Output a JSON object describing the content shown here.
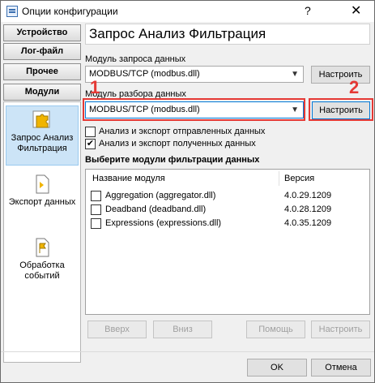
{
  "window": {
    "title": "Опции конфигурации",
    "help_glyph": "?",
    "close_glyph": "✕"
  },
  "nav": {
    "buttons": [
      "Устройство",
      "Лог-файл",
      "Прочее",
      "Модули"
    ],
    "items": [
      {
        "label": "Запрос Анализ Фильтрация",
        "icon": "puzzle-icon",
        "selected": true
      },
      {
        "label": "Экспорт данных",
        "icon": "export-icon",
        "selected": false
      },
      {
        "label": "Обработка событий",
        "icon": "event-flag-icon",
        "selected": false
      }
    ]
  },
  "panel": {
    "heading": "Запрос Анализ Фильтрация",
    "request_module_label": "Модуль запроса данных",
    "request_module_value": "MODBUS/TCP (modbus.dll)",
    "parse_module_label": "Модуль разбора данных",
    "parse_module_value": "MODBUS/TCP (modbus.dll)",
    "configure_label": "Настроить",
    "check_sent_label": "Анализ и экспорт отправленных данных",
    "check_sent": false,
    "check_received_label": "Анализ и экспорт полученных данных",
    "check_received": true,
    "filter_title": "Выберите модули фильтрации данных",
    "columns": {
      "name": "Название модуля",
      "version": "Версия"
    },
    "filter_modules": [
      {
        "name": "Aggregation (aggregator.dll)",
        "version": "4.0.29.1209",
        "checked": false
      },
      {
        "name": "Deadband (deadband.dll)",
        "version": "4.0.28.1209",
        "checked": false
      },
      {
        "name": "Expressions (expressions.dll)",
        "version": "4.0.35.1209",
        "checked": false
      }
    ],
    "up_label": "Вверх",
    "down_label": "Вниз",
    "help_label": "Помощь",
    "configure_filter_label": "Настроить"
  },
  "markers": {
    "one": "1",
    "two": "2"
  },
  "footer": {
    "ok_label": "OK",
    "cancel_label": "Отмена"
  },
  "colors": {
    "annotation_red": "#e53935",
    "selection_blue": "#cce4f7",
    "focus_blue": "#0078d7"
  }
}
